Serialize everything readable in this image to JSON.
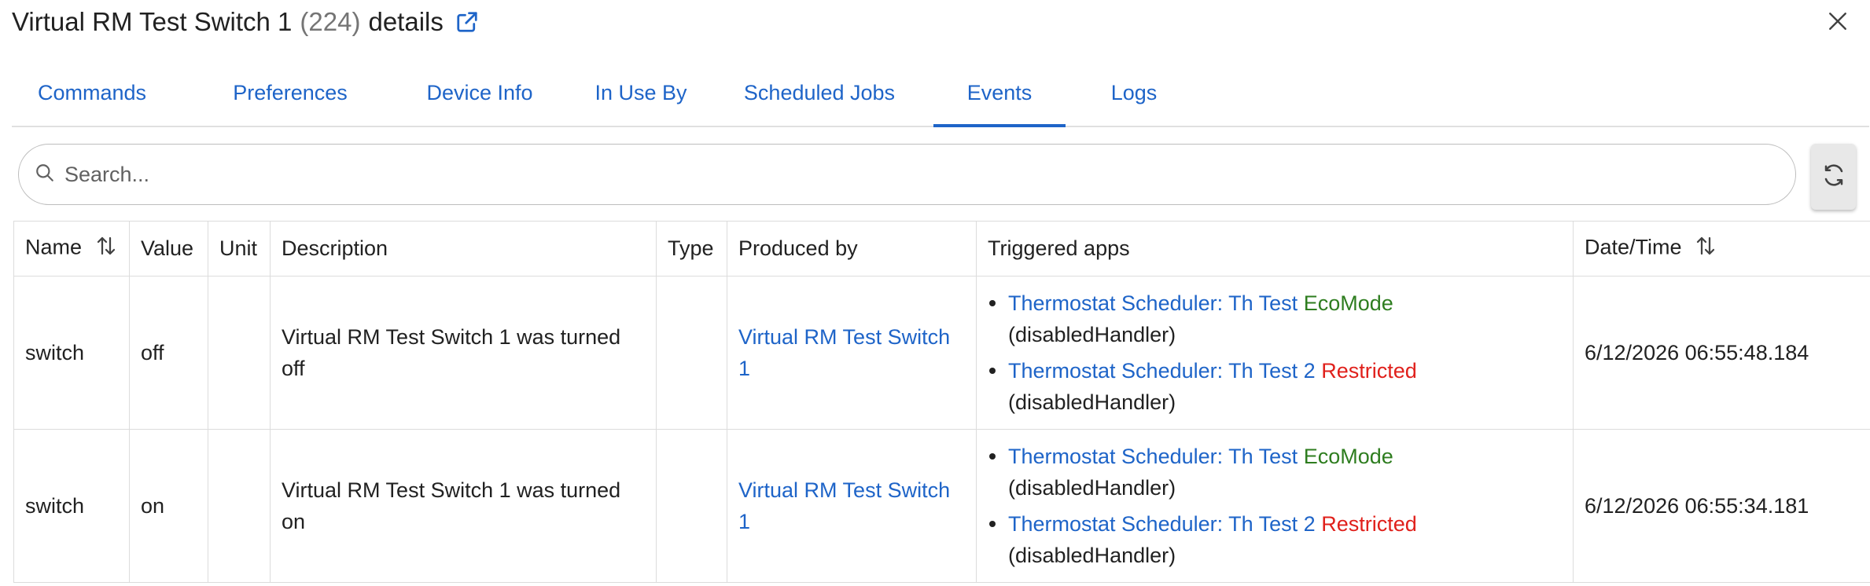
{
  "header": {
    "title": "Virtual RM Test Switch 1",
    "device_id": "(224)",
    "suffix": "details"
  },
  "tabs": [
    "Commands",
    "Preferences",
    "Device Info",
    "In Use By",
    "Scheduled Jobs",
    "Events",
    "Logs"
  ],
  "active_tab": "Events",
  "search": {
    "placeholder": "Search...",
    "value": ""
  },
  "table": {
    "columns": [
      "Name",
      "Value",
      "Unit",
      "Description",
      "Type",
      "Produced by",
      "Triggered apps",
      "Date/Time"
    ],
    "rows": [
      {
        "name": "switch",
        "value": "off",
        "unit": "",
        "description": "Virtual RM Test Switch 1 was turned off",
        "type": "",
        "produced_by": "Virtual RM Test Switch 1",
        "apps": [
          {
            "name": "Thermostat Scheduler: Th Test",
            "status": "EcoMode",
            "handler": "(disabledHandler)"
          },
          {
            "name": "Thermostat Scheduler: Th Test 2",
            "status": "Restricted",
            "handler": "(disabledHandler)"
          }
        ],
        "datetime": "6/12/2026 06:55:48.184"
      },
      {
        "name": "switch",
        "value": "on",
        "unit": "",
        "description": "Virtual RM Test Switch 1 was turned on",
        "type": "",
        "produced_by": "Virtual RM Test Switch 1",
        "apps": [
          {
            "name": "Thermostat Scheduler: Th Test",
            "status": "EcoMode",
            "handler": "(disabledHandler)"
          },
          {
            "name": "Thermostat Scheduler: Th Test 2",
            "status": "Restricted",
            "handler": "(disabledHandler)"
          }
        ],
        "datetime": "6/12/2026 06:55:34.181"
      }
    ]
  },
  "icons": {
    "external_link": "external-link-icon",
    "close": "close-icon",
    "search": "search-icon",
    "refresh": "refresh-icon",
    "sort": "sort-icon"
  },
  "colors": {
    "accent": "#1e64c8",
    "status_green": "#2e7d1f",
    "status_red": "#e0201b",
    "muted": "#757575"
  }
}
